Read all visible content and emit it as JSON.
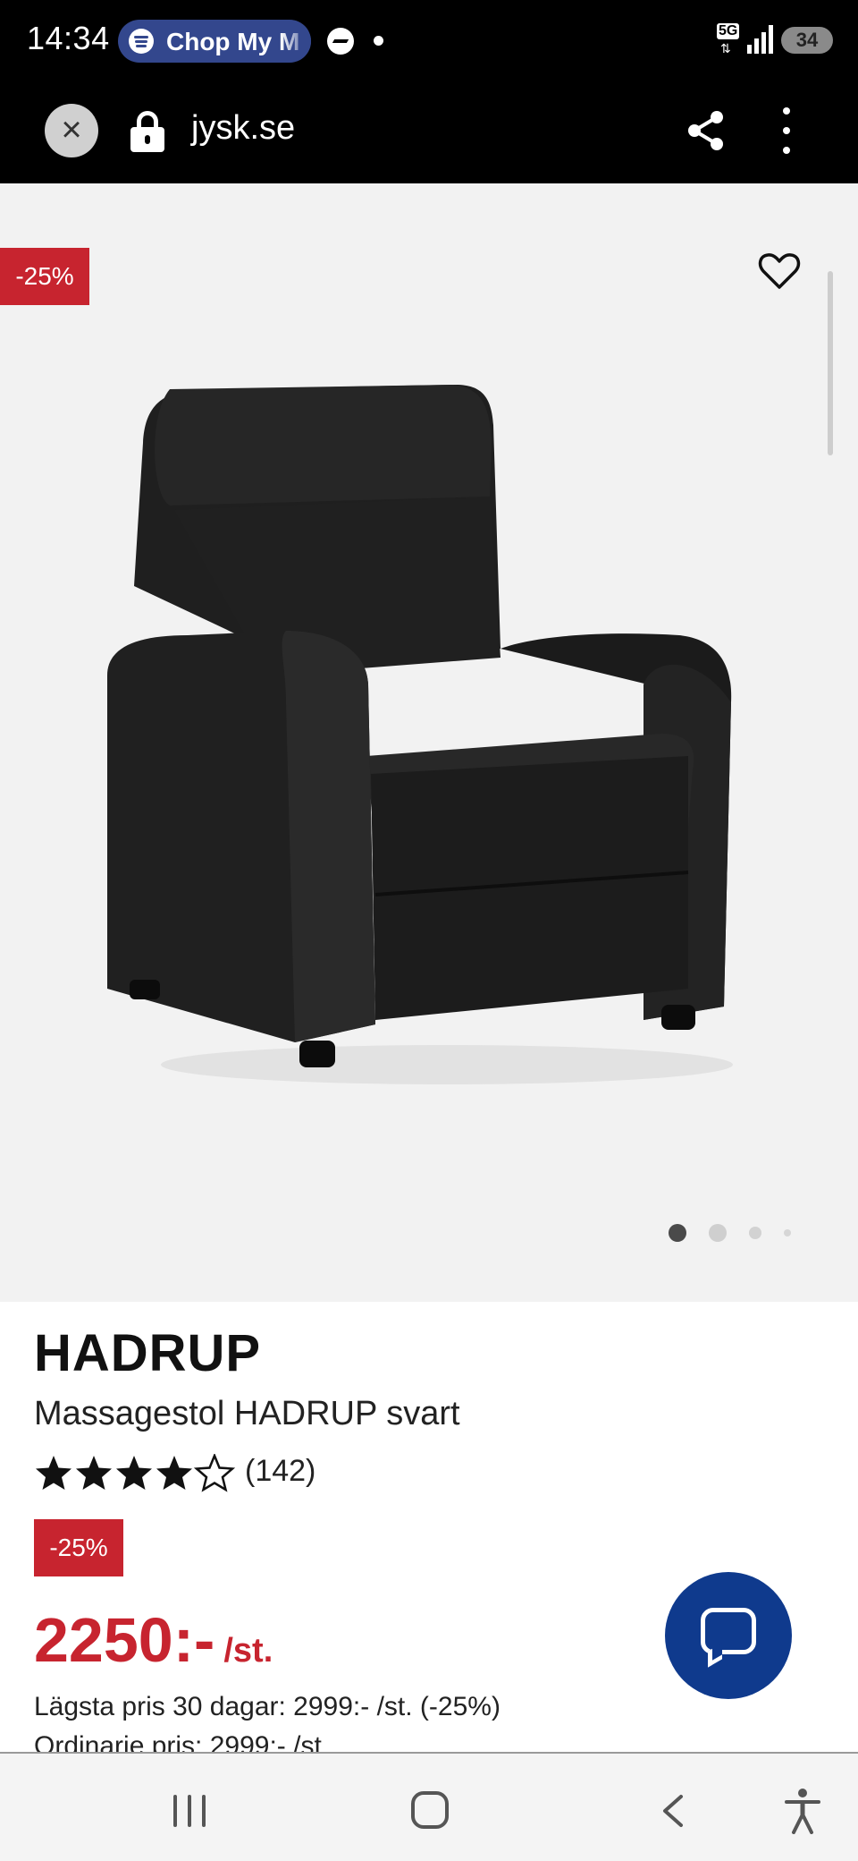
{
  "status_bar": {
    "time": "14:34",
    "media_app": "Chop My M",
    "network": "5G",
    "battery": "34"
  },
  "browser": {
    "url": "jysk.se",
    "close_icon": "close-icon",
    "lock_icon": "lock-icon",
    "share_icon": "share-icon",
    "menu_icon": "more-vertical-icon"
  },
  "gallery": {
    "discount_tag": "-25%",
    "current_slide": 1,
    "total_slides": 4
  },
  "product": {
    "brand": "HADRUP",
    "name": "Massagestol HADRUP svart",
    "rating": 4,
    "rating_max": 5,
    "review_count": "(142)",
    "discount_badge": "-25%",
    "price": "2250:-",
    "price_unit": "/st.",
    "lowest_price_text": "Lägsta pris 30 dagar: 2999:- /st. (-25%)",
    "regular_price_text": "Ordinarie pris: 2999:- /st"
  },
  "colors": {
    "accent_red": "#c7242f",
    "chat_blue": "#0f3a8d",
    "spotify_pill": "#33478d"
  },
  "nav": {
    "recent_icon": "recent-apps-icon",
    "home_icon": "home-icon",
    "back_icon": "back-icon",
    "accessibility_icon": "accessibility-icon"
  }
}
